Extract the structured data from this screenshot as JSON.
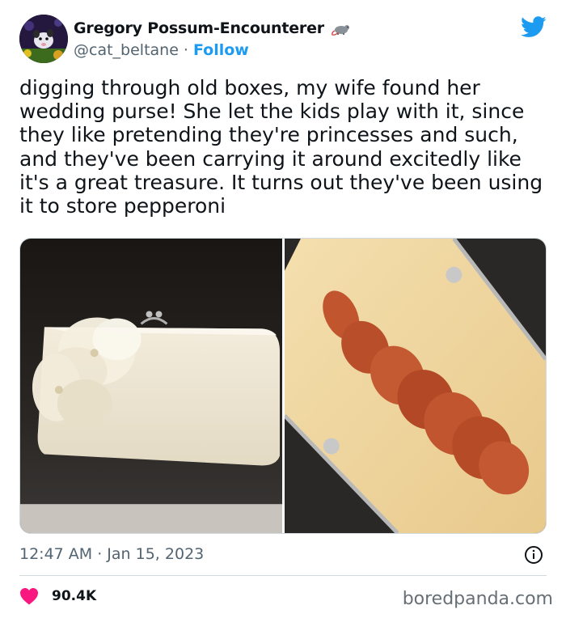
{
  "author": {
    "display_name": "Gregory Possum-Encounterer",
    "handle": "@cat_beltane",
    "separator": "·",
    "follow_label": "Follow",
    "avatar_icon": "possum-avatar",
    "name_badge_icon": "rat-emoji"
  },
  "brand": {
    "logo_icon": "twitter-bird-icon",
    "accent_color": "#1d9bf0"
  },
  "tweet": {
    "text": "digging through old boxes, my wife found her wedding purse! She let the kids play with it, since they like pretending they're princesses and such, and they've been carrying it around excitedly like it's a great treasure. It turns out they've been using it to store pepperoni",
    "photos": [
      {
        "name": "closed-white-purse-photo"
      },
      {
        "name": "open-purse-pepperoni-photo"
      }
    ],
    "timestamp": "12:47 AM · Jan 15, 2023",
    "info_icon": "info-icon"
  },
  "engagement": {
    "like_icon": "heart-icon",
    "like_color": "#f91880",
    "likes": "90.4K"
  },
  "watermark": "boredpanda.com"
}
